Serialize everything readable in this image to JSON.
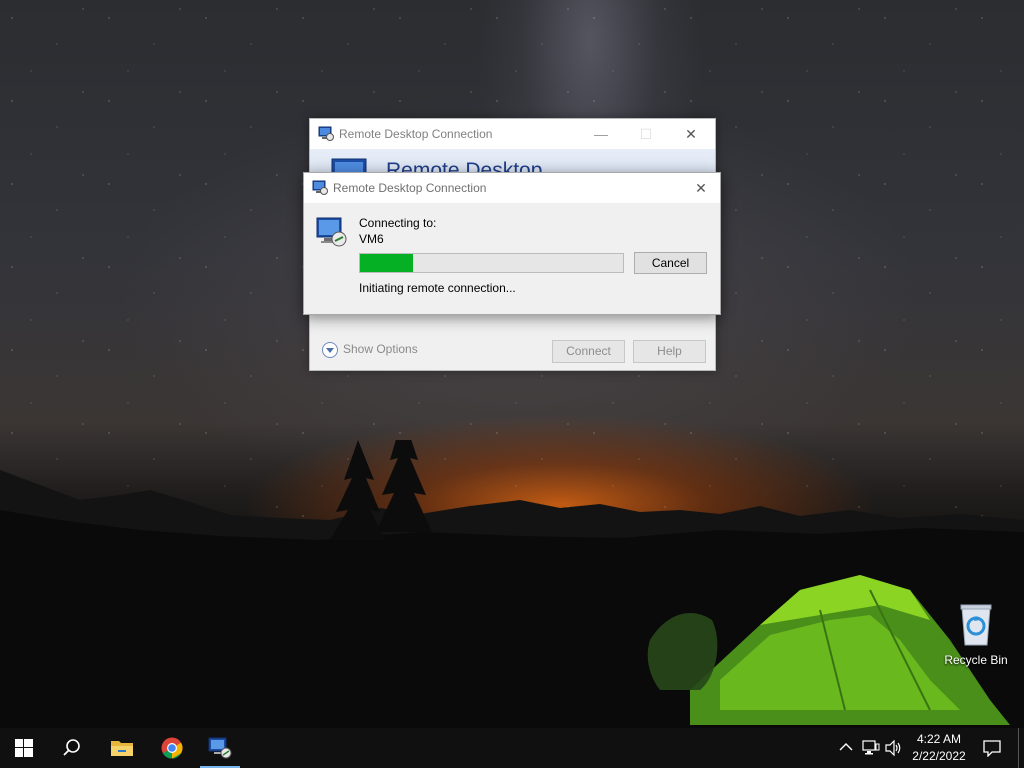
{
  "desktop": {
    "icons": [
      {
        "label": "Recycle Bin",
        "icon": "recycle-bin-icon"
      }
    ]
  },
  "rdc_main": {
    "title": "Remote Desktop Connection",
    "banner": "Remote Desktop",
    "show_options": "Show Options",
    "connect_label": "Connect",
    "help_label": "Help"
  },
  "rdc_dialog": {
    "title": "Remote Desktop Connection",
    "connecting_label": "Connecting to:",
    "host": "VM6",
    "progress_percent": 20,
    "cancel_label": "Cancel",
    "status": "Initiating remote connection..."
  },
  "taskbar": {
    "items": [
      {
        "name": "start",
        "icon": "windows-logo-icon"
      },
      {
        "name": "search",
        "icon": "search-icon"
      },
      {
        "name": "file-explorer",
        "icon": "folder-icon"
      },
      {
        "name": "chrome",
        "icon": "chrome-icon"
      },
      {
        "name": "remote-desktop",
        "icon": "remote-desktop-icon",
        "active": true
      }
    ],
    "tray": {
      "icons": [
        "chevron-up-icon",
        "network-icon",
        "volume-icon",
        "notifications-icon"
      ],
      "time": "4:22 AM",
      "date": "2/22/2022"
    }
  },
  "colors": {
    "progress_fill": "#06b025",
    "taskbar_bg": "#101010",
    "active_underline": "#7ab6ee",
    "banner_text": "#1f3e8a"
  }
}
